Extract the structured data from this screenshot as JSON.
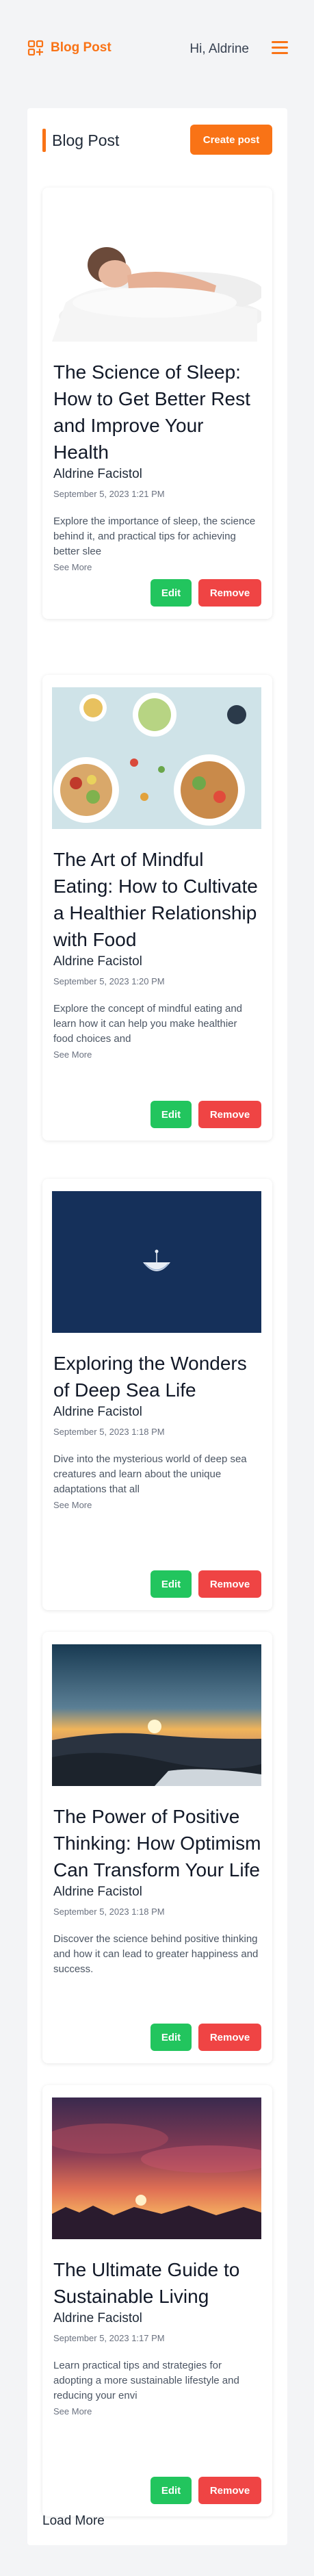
{
  "header": {
    "brand": "Blog Post",
    "brand_icon": "blog-grid-icon",
    "greeting": "Hi, Aldrine",
    "menu_icon": "hamburger-icon",
    "accent_color": "#f97316"
  },
  "panel": {
    "title": "Blog Post",
    "create_label": "Create post"
  },
  "posts": [
    {
      "title": "The Science of Sleep: How to Get Better Rest and Improve Your Health",
      "author": "Aldrine Facistol",
      "date": "September 5, 2023 1:21 PM",
      "excerpt": "Explore the importance of sleep, the science behind it, and practical tips for achieving better slee",
      "see_more": "See More",
      "edit_label": "Edit",
      "remove_label": "Remove"
    },
    {
      "title": "The Art of Mindful Eating: How to Cultivate a Healthier Relationship with Food",
      "author": "Aldrine Facistol",
      "date": "September 5, 2023 1:20 PM",
      "excerpt": "Explore the concept of mindful eating and learn how it can help you make healthier food choices and",
      "see_more": "See More",
      "edit_label": "Edit",
      "remove_label": "Remove"
    },
    {
      "title": "Exploring the Wonders of Deep Sea Life",
      "author": "Aldrine Facistol",
      "date": "September 5, 2023 1:18 PM",
      "excerpt": "Dive into the mysterious world of deep sea creatures and learn about the unique adaptations that all",
      "see_more": "See More",
      "edit_label": "Edit",
      "remove_label": "Remove"
    },
    {
      "title": "The Power of Positive Thinking: How Optimism Can Transform Your Life",
      "author": "Aldrine Facistol",
      "date": "September 5, 2023 1:18 PM",
      "excerpt": "Discover the science behind positive thinking and how it can lead to greater happiness and success.",
      "see_more": "",
      "edit_label": "Edit",
      "remove_label": "Remove"
    },
    {
      "title": "The Ultimate Guide to Sustainable Living",
      "author": "Aldrine Facistol",
      "date": "September 5, 2023 1:17 PM",
      "excerpt": "Learn practical tips and strategies for adopting a more sustainable lifestyle and reducing your envi",
      "see_more": "See More",
      "edit_label": "Edit",
      "remove_label": "Remove"
    }
  ],
  "load_more": "Load More"
}
